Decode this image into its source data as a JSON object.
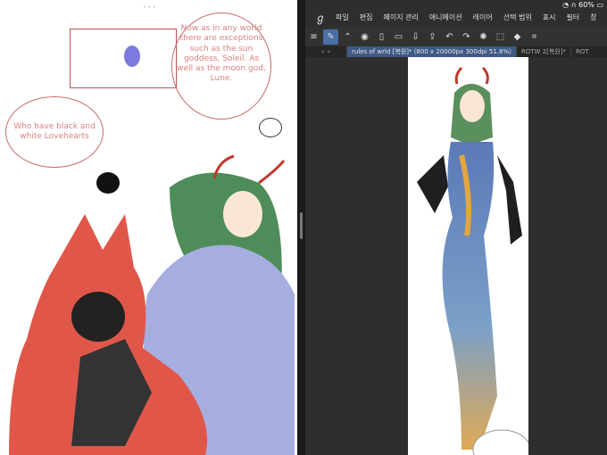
{
  "left_panel": {
    "bubble_main": "Now as in any world there are exceptions such as the sun goddess, Soleil. As well as the moon god, Lune.",
    "bubble_small": "Who have black and white Lovehearts"
  },
  "status_bar": {
    "battery": "60%"
  },
  "menu": {
    "items": [
      "파일",
      "편집",
      "페이지 관리",
      "애니메이션",
      "레이어",
      "선택 범위",
      "표시",
      "필터",
      "창"
    ]
  },
  "toolbar": {
    "icons": [
      "menu-icon",
      "pen-icon",
      "chevron-icon",
      "camera-icon",
      "new-file-icon",
      "open-icon",
      "save-icon",
      "export-icon",
      "undo-icon",
      "redo-icon",
      "loading-icon",
      "transform-icon",
      "fill-icon",
      "crop-icon"
    ]
  },
  "tabs": [
    {
      "label": "rules of wrld [복원]* (800 x 20000px 300dpi 51.8%)",
      "active": true
    },
    {
      "label": "ROTW 2[복원]*",
      "active": false
    },
    {
      "label": "ROT",
      "active": false
    }
  ],
  "colors": {
    "accent": "#4a6fa5",
    "panel": "#2e2e2e",
    "bubble_text": "#d98282"
  }
}
